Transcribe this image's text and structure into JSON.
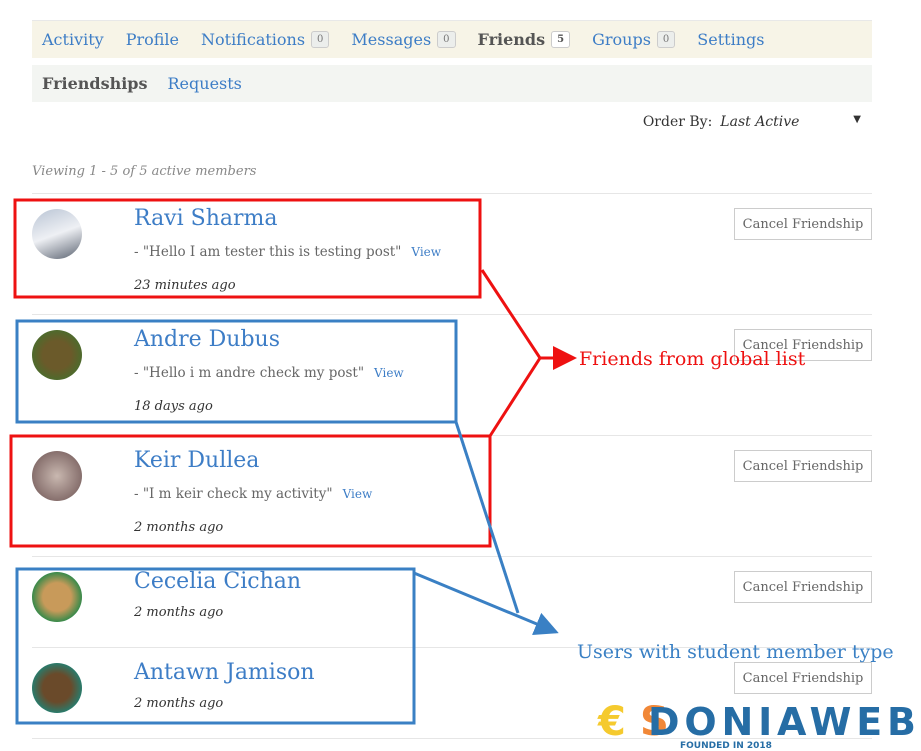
{
  "nav": {
    "items": [
      {
        "label": "Activity"
      },
      {
        "label": "Profile"
      },
      {
        "label": "Notifications",
        "count": "0"
      },
      {
        "label": "Messages",
        "count": "0"
      },
      {
        "label": "Friends",
        "count": "5",
        "current": true
      },
      {
        "label": "Groups",
        "count": "0"
      },
      {
        "label": "Settings"
      }
    ]
  },
  "subnav": {
    "friendships": "Friendships",
    "requests": "Requests"
  },
  "order": {
    "label": "Order By:",
    "value": "Last Active"
  },
  "viewing": "Viewing 1 - 5 of 5 active members",
  "members": [
    {
      "name": "Ravi Sharma",
      "update": "- \"Hello I am tester this is testing post\"",
      "view": "View",
      "time": "23 minutes ago",
      "action": "Cancel Friendship"
    },
    {
      "name": "Andre Dubus",
      "update": "- \"Hello i m andre check my post\"",
      "view": "View",
      "time": "18 days ago",
      "action": "Cancel Friendship"
    },
    {
      "name": "Keir Dullea",
      "update": "- \"I m keir check my activity\"",
      "view": "View",
      "time": "2 months ago",
      "action": "Cancel Friendship"
    },
    {
      "name": "Cecelia Cichan",
      "time": "2 months ago",
      "action": "Cancel Friendship"
    },
    {
      "name": "Antawn Jamison",
      "time": "2 months ago",
      "action": "Cancel Friendship"
    }
  ],
  "annotations": {
    "global": "Friends from global list",
    "student": "Users with student member type",
    "red": "#ee1111",
    "blue": "#3a80c4"
  },
  "watermark": {
    "brand": "DONIAWEB",
    "tagline": "FOUNDED IN 2018"
  }
}
